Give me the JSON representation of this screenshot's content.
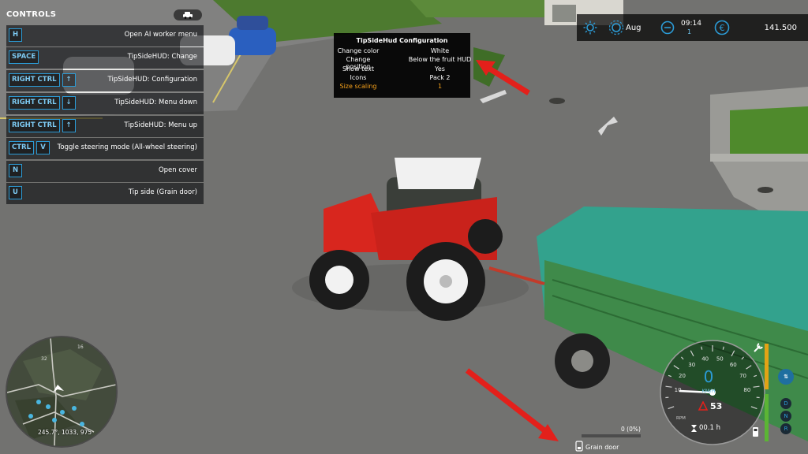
{
  "controls": {
    "title": "CONTROLS",
    "rows": [
      {
        "keys": [
          "H"
        ],
        "label": "Open AI worker menu"
      },
      {
        "keys": [
          "SPACE"
        ],
        "label": "TipSideHUD: Change"
      },
      {
        "keys": [
          "RIGHT CTRL",
          "↑"
        ],
        "label": "TipSideHUD: Configuration"
      },
      {
        "keys": [
          "RIGHT CTRL",
          "↓"
        ],
        "label": "TipSideHUD: Menu down"
      },
      {
        "keys": [
          "RIGHT CTRL",
          "↑"
        ],
        "label": "TipSideHUD: Menu up"
      },
      {
        "keys": [
          "CTRL",
          "V"
        ],
        "label": "Toggle steering mode (All-wheel steering)"
      },
      {
        "keys": [
          "N"
        ],
        "label": "Open cover"
      },
      {
        "keys": [
          "U"
        ],
        "label": "Tip side (Grain door)"
      }
    ]
  },
  "tipsidehud": {
    "title": "TipSideHud Configuration",
    "rows": [
      {
        "key": "Change color",
        "value": "White",
        "selected": false
      },
      {
        "key": "Change position",
        "value": "Below the fruit HUD",
        "selected": false
      },
      {
        "key": "Show text",
        "value": "Yes",
        "selected": false
      },
      {
        "key": "Icons",
        "value": "Pack 2",
        "selected": false
      },
      {
        "key": "Size scaling",
        "value": "1",
        "selected": true
      }
    ],
    "highlight_color": "#f7a21b"
  },
  "tophud": {
    "weather_icon": "sun-icon",
    "season_icon": "season-gear-icon",
    "season": "Aug",
    "clock_icon": "clock-icon",
    "time": "09:14",
    "time_speed": "1",
    "money_icon": "euro-icon",
    "money": "141.500"
  },
  "minimap": {
    "coords": "245.7°, 1033, 975",
    "labels": [
      "32",
      "16"
    ]
  },
  "fill": {
    "level_fraction": 0.0,
    "text": "0 (0%)",
    "name": "Grain door",
    "icon": "trailer-icon"
  },
  "speedometer": {
    "speed": "0",
    "unit": "KM/H",
    "rpm_label": "RPM",
    "fuel_percent": "53",
    "operating_time": "00.1 h",
    "ticks": [
      "10",
      "20",
      "30",
      "40",
      "50",
      "60",
      "70",
      "80"
    ],
    "gear_indicators": [
      "D",
      "N",
      "R"
    ]
  },
  "colors": {
    "accent": "#2b9bd6",
    "arrow_red": "#e3201b"
  }
}
